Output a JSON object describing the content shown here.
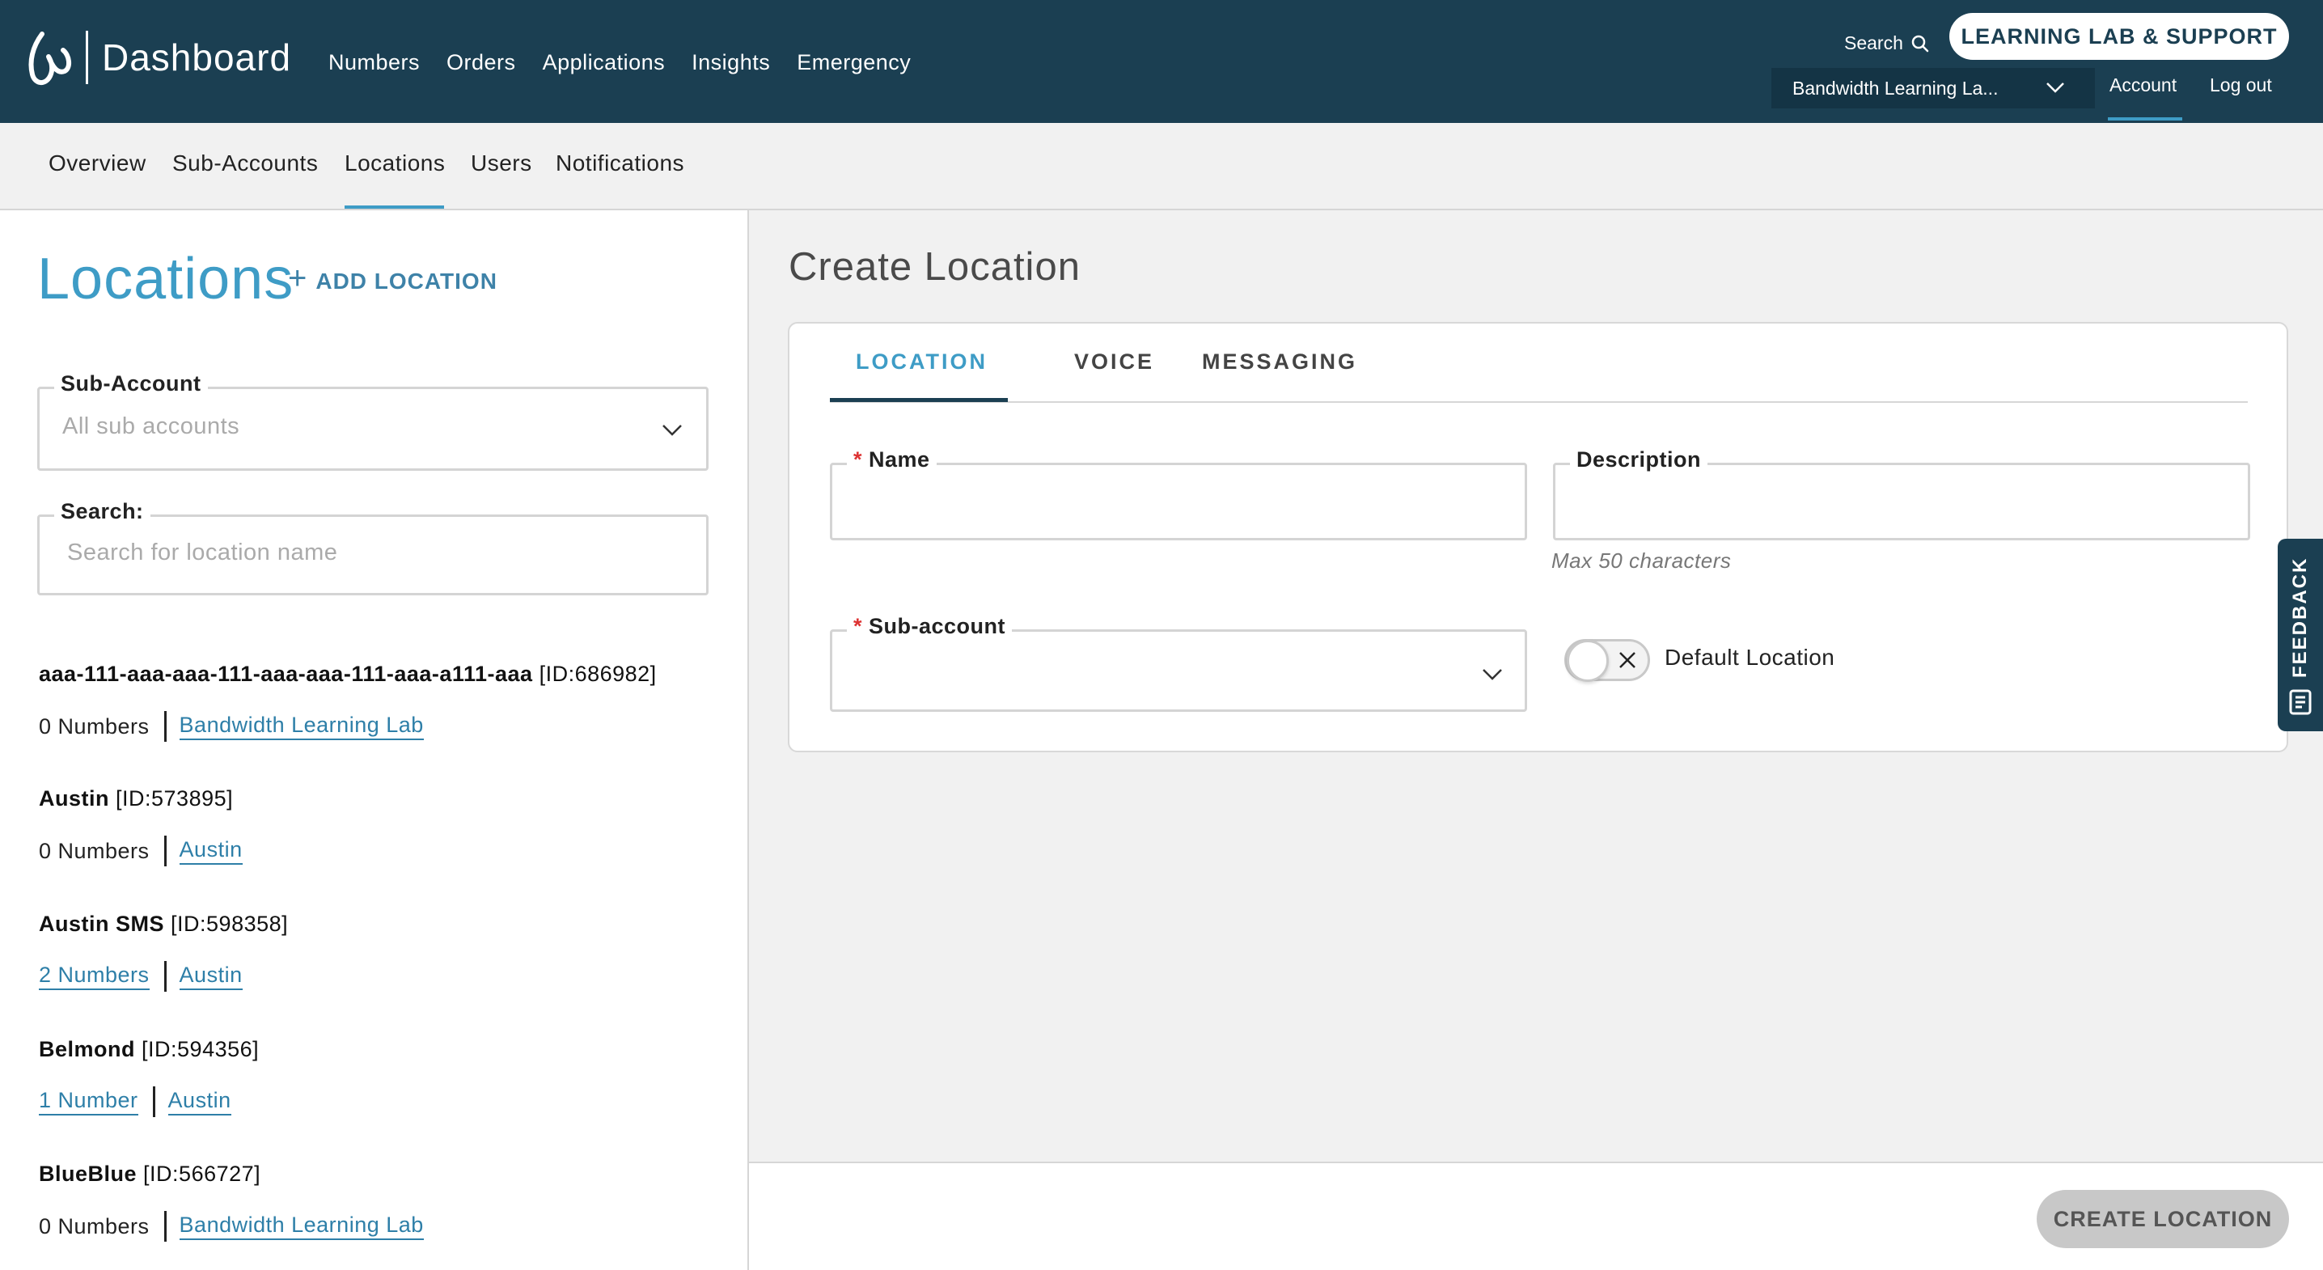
{
  "header": {
    "brand": "Dashboard",
    "nav": [
      "Numbers",
      "Orders",
      "Applications",
      "Insights",
      "Emergency"
    ],
    "search_label": "Search",
    "lab_button": "LEARNING LAB & SUPPORT",
    "account_select": "Bandwidth Learning La...",
    "account_link": "Account",
    "logout_link": "Log out"
  },
  "subnav": [
    "Overview",
    "Sub-Accounts",
    "Locations",
    "Users",
    "Notifications"
  ],
  "left": {
    "title": "Locations",
    "add_label": "ADD LOCATION",
    "sub_account_label": "Sub-Account",
    "sub_account_placeholder": "All sub accounts",
    "search_label": "Search:",
    "search_placeholder": "Search for location name",
    "locations": [
      {
        "name": "aaa-111-aaa-aaa-111-aaa-aaa-111-aaa-a111-aaa",
        "id": "[ID:686982]",
        "numbers": "0 Numbers",
        "sub": "Bandwidth Learning Lab"
      },
      {
        "name": "Austin",
        "id": "[ID:573895]",
        "numbers": "0 Numbers",
        "sub": "Austin"
      },
      {
        "name": "Austin SMS",
        "id": "[ID:598358]",
        "numbers": "2 Numbers",
        "sub": "Austin"
      },
      {
        "name": "Belmond",
        "id": "[ID:594356]",
        "numbers": "1 Number",
        "sub": "Austin"
      },
      {
        "name": "BlueBlue",
        "id": "[ID:566727]",
        "numbers": "0 Numbers",
        "sub": "Bandwidth Learning Lab"
      }
    ]
  },
  "right": {
    "title": "Create Location",
    "tabs": [
      "LOCATION",
      "VOICE",
      "MESSAGING"
    ],
    "name_label": "Name",
    "name_value": "",
    "description_label": "Description",
    "description_value": "",
    "description_hint": "Max 50 characters",
    "sub_account_label": "Sub-account",
    "default_location_label": "Default Location",
    "default_location_on": false,
    "create_button": "CREATE LOCATION",
    "feedback": "FEEDBACK"
  },
  "colors": {
    "header_bg": "#1b3f52",
    "accent": "#3e9cc6",
    "link": "#2e7fa8",
    "required": "#dd3333"
  }
}
